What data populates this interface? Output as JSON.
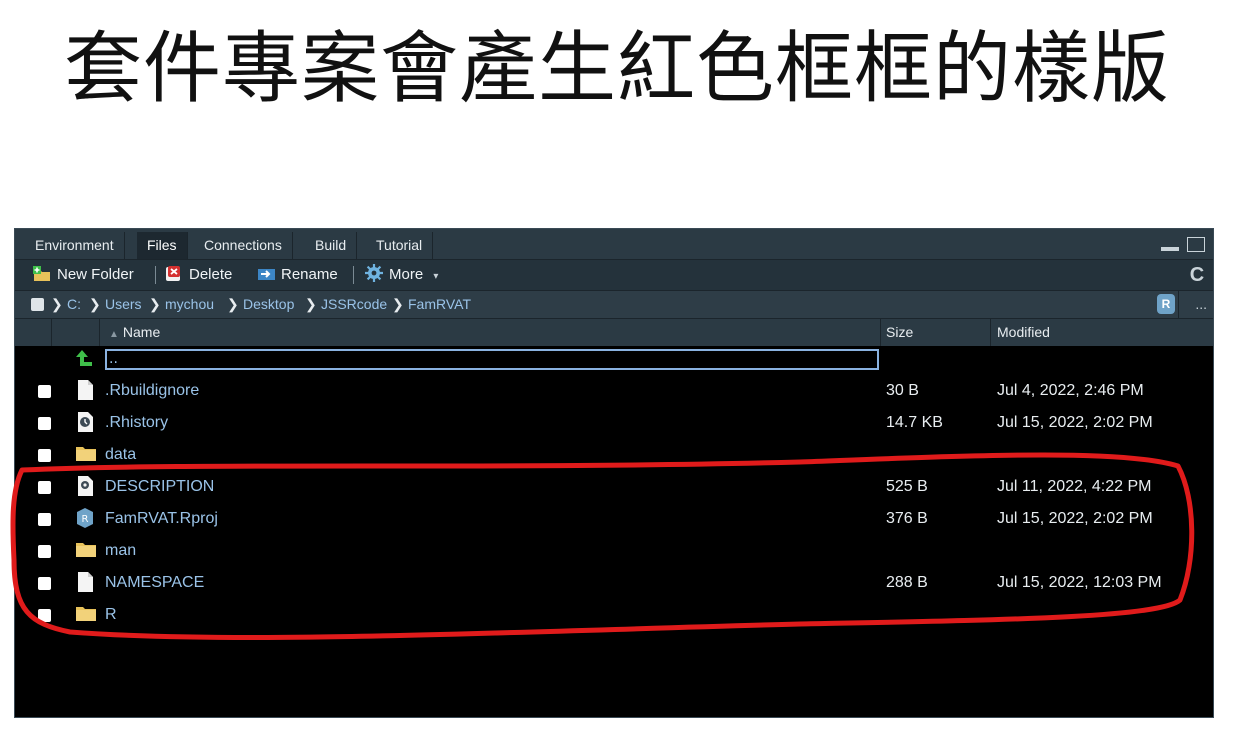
{
  "slide": {
    "title": "套件專案會產生紅色框框的樣版"
  },
  "tabs": [
    {
      "label": "Environment"
    },
    {
      "label": "Files"
    },
    {
      "label": "Connections"
    },
    {
      "label": "Build"
    },
    {
      "label": "Tutorial"
    }
  ],
  "toolbar": {
    "new_folder": "New Folder",
    "delete": "Delete",
    "rename": "Rename",
    "more": "More",
    "more_caret": "▾"
  },
  "breadcrumb": {
    "items": [
      "C:",
      "Users",
      "mychou",
      "Desktop",
      "JSSRcode",
      "FamRVAT"
    ],
    "rproj_badge": "R",
    "more": "..."
  },
  "columns": {
    "name": "Name",
    "sort_indicator": "▲",
    "size": "Size",
    "modified": "Modified"
  },
  "parent_dir": {
    "value": ".."
  },
  "files": [
    {
      "name": ".Rbuildignore",
      "size": "30 B",
      "modified": "Jul 4, 2022, 2:46 PM",
      "icon": "file-icon"
    },
    {
      "name": ".Rhistory",
      "size": "14.7 KB",
      "modified": "Jul 15, 2022, 2:02 PM",
      "icon": "history-file-icon"
    },
    {
      "name": "data",
      "size": "",
      "modified": "",
      "icon": "folder-icon"
    },
    {
      "name": "DESCRIPTION",
      "size": "525 B",
      "modified": "Jul 11, 2022, 4:22 PM",
      "icon": "description-file-icon"
    },
    {
      "name": "FamRVAT.Rproj",
      "size": "376 B",
      "modified": "Jul 15, 2022, 2:02 PM",
      "icon": "rproj-icon"
    },
    {
      "name": "man",
      "size": "",
      "modified": "",
      "icon": "folder-icon"
    },
    {
      "name": "NAMESPACE",
      "size": "288 B",
      "modified": "Jul 15, 2022, 12:03 PM",
      "icon": "file-icon"
    },
    {
      "name": "R",
      "size": "",
      "modified": "",
      "icon": "folder-icon"
    }
  ],
  "colors": {
    "annotation": "#e01b1b",
    "link": "#9ac3e8",
    "folder": "#e8c25a",
    "up_arrow": "#3fbf4a"
  }
}
